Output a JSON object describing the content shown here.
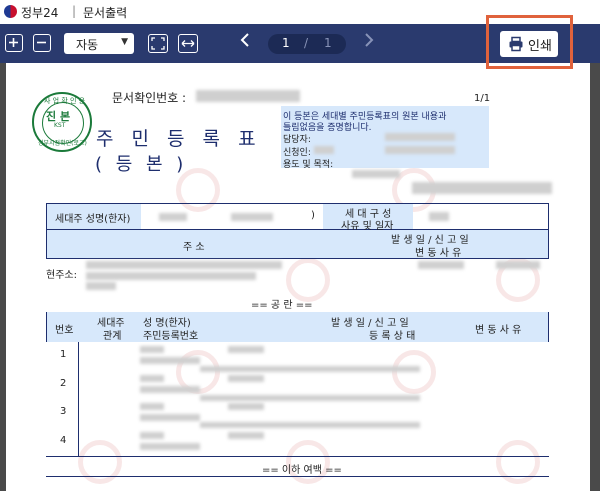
{
  "titlebar": {
    "app_name": "정부24",
    "separator": "|",
    "window_title": "문서출력"
  },
  "toolbar": {
    "zoom_value": "자동",
    "page_current": "1",
    "page_separator": "/",
    "page_total": "1",
    "print_label": "인쇄"
  },
  "document": {
    "seal": {
      "top_text": "사 업 확 인 용",
      "middle_text": "진 본",
      "kst_text": "KST",
      "bottom_text": "정부시점확인(로고)"
    },
    "docnum_label": "문서확인번호 :",
    "page_fraction": "1/1",
    "title": "주 민 등 록 표",
    "subtitle": "( 등  본 )",
    "info_line1": "이 등본은 세대별 주민등록표의 원본 내용과",
    "info_line2": "틀림없음을 증명합니다.",
    "info_label_officer": "담당자:",
    "info_label_applicant": "신청인:",
    "info_label_purpose": "용도 및 목적:",
    "householder_label": "세대주 성명(한자)",
    "household_paren": ")",
    "household_reason_line1": "세 대 구 성",
    "household_reason_line2": "사유 및 일자",
    "address_header": "주          소",
    "date_header_line1": "발 생 일 / 신 고 일",
    "date_header_line2": "변    동    사    유",
    "current_address_label": "현주소:",
    "vacancy_label": "== 공   란 ==",
    "col_no": "번호",
    "col_rel_line1": "세대주",
    "col_rel_line2": "관계",
    "col_name_line1": "성 명(한자)",
    "col_name_line2": "주민등록번호",
    "col_date_line1": "발 생 일 / 신 고 일",
    "col_date_line2": "등 록 상 태",
    "col_change": "변 동 사 유",
    "rows": [
      "1",
      "2",
      "3",
      "4"
    ],
    "end_label": "== 이하 여백 =="
  }
}
